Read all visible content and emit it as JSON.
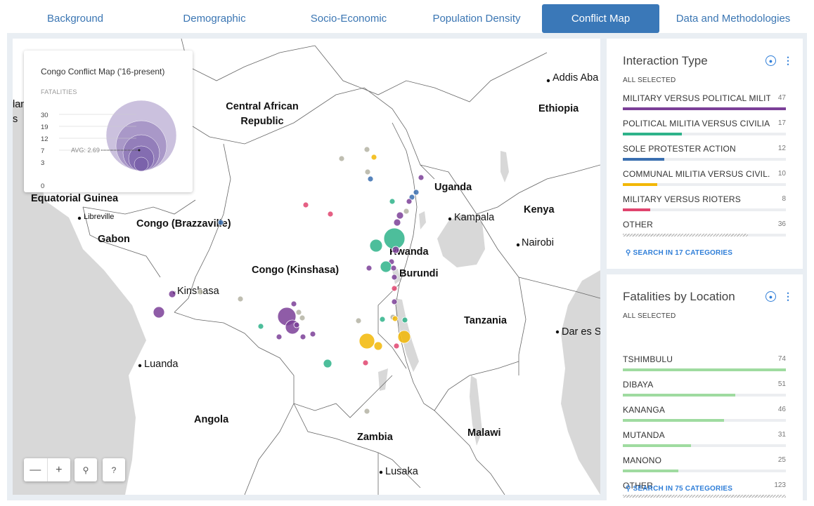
{
  "tabs": [
    {
      "label": "Background"
    },
    {
      "label": "Demographic"
    },
    {
      "label": "Socio-Economic"
    },
    {
      "label": "Population Density"
    },
    {
      "label": "Conflict Map"
    },
    {
      "label": "Data and Methodologies"
    }
  ],
  "active_tab": "Conflict Map",
  "map": {
    "labels": {
      "car": [
        "Central African",
        "Republic"
      ],
      "ethiopia": "Ethiopia",
      "addis": "Addis Aba",
      "uganda": "Uganda",
      "kampala": "Kampala",
      "kenya": "Kenya",
      "nairobi": "Nairobi",
      "rwanda": "Rwanda",
      "burundi": "Burundi",
      "tanzania": "Tanzania",
      "dares": "Dar es S",
      "congo_kin": "Congo (Kinshasa)",
      "congo_braz": "Congo (Brazzaville)",
      "gabon": "Gabon",
      "libreville": "Libreville",
      "eq_guinea": "Equatorial Guinea",
      "kinshasa": "Kinshasa",
      "luanda": "Luanda",
      "angola": "Angola",
      "zambia": "Zambia",
      "malawi": "Malawi",
      "lusaka": "Lusaka",
      "edge_lan": "lan",
      "edge_s": "s"
    },
    "legend": {
      "title": "Congo Conflict Map ('16-present)",
      "metric": "FATALITIES",
      "ticks": [
        "30",
        "19",
        "12",
        "7",
        "3",
        "0"
      ],
      "avg_label": "AVG: 2.69"
    },
    "controls": {
      "zoom_out": "—",
      "zoom_in": "+",
      "search": "⚲",
      "help": "?"
    },
    "colors": {
      "purple": "#7b3f98",
      "green": "#2eb38a",
      "blue": "#3a6fb0",
      "yellow": "#f2b705",
      "pink": "#e0446e",
      "gray": "#b4b3a3"
    }
  },
  "interaction_type": {
    "title": "Interaction Type",
    "all_selected": "ALL SELECTED",
    "categories": [
      {
        "name": "MILITARY VERSUS POLITICAL MILIT...",
        "value": 47,
        "fraction": 1.0,
        "color": "#7b3f98"
      },
      {
        "name": "POLITICAL MILITIA VERSUS CIVILIA...",
        "value": 17,
        "fraction": 0.36,
        "color": "#2eb38a"
      },
      {
        "name": "SOLE PROTESTER ACTION",
        "value": 12,
        "fraction": 0.255,
        "color": "#3a6fb0"
      },
      {
        "name": "COMMUNAL MILITIA VERSUS CIVIL...",
        "value": 10,
        "fraction": 0.213,
        "color": "#f2b705"
      },
      {
        "name": "MILITARY VERSUS RIOTERS",
        "value": 8,
        "fraction": 0.17,
        "color": "#e0446e"
      },
      {
        "name": "OTHER",
        "value": 36,
        "fraction": 0.766,
        "color": "hatch"
      }
    ],
    "search": "SEARCH IN 17 CATEGORIES"
  },
  "fatalities_by_location": {
    "title": "Fatalities by Location",
    "all_selected": "ALL SELECTED",
    "categories": [
      {
        "name": "TSHIMBULU",
        "value": 74,
        "fraction": 1.0,
        "color": "#9fdba0"
      },
      {
        "name": "DIBAYA",
        "value": 51,
        "fraction": 0.69,
        "color": "#9fdba0"
      },
      {
        "name": "KANANGA",
        "value": 46,
        "fraction": 0.62,
        "color": "#9fdba0"
      },
      {
        "name": "MUTANDA",
        "value": 31,
        "fraction": 0.42,
        "color": "#9fdba0"
      },
      {
        "name": "MANONO",
        "value": 25,
        "fraction": 0.34,
        "color": "#9fdba0"
      },
      {
        "name": "OTHER",
        "value": 123,
        "fraction": 1.0,
        "color": "hatch"
      }
    ],
    "search": "SEARCH IN 75 CATEGORIES"
  }
}
